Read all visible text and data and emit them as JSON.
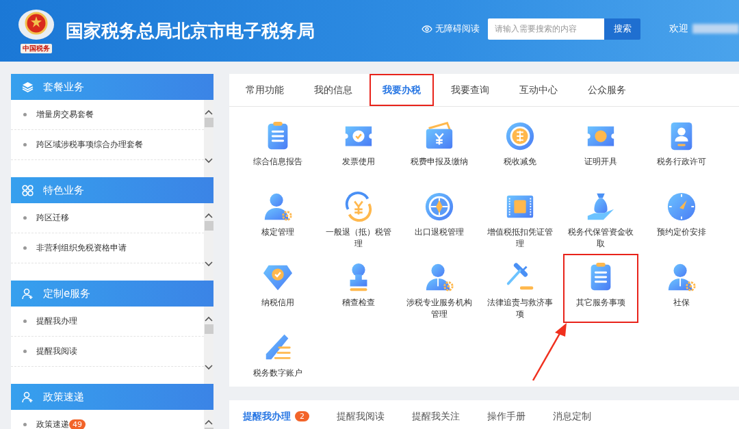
{
  "header": {
    "logo_caption": "中国税务",
    "title": "国家税务总局北京市电子税务局",
    "accessibility_link": "无障碍阅读",
    "search": {
      "placeholder": "请输入需要搜索的内容",
      "button": "搜索"
    },
    "welcome": "欢迎"
  },
  "sidebar": [
    {
      "title": "套餐业务",
      "kind": "layers",
      "items": [
        "增量房交易套餐",
        "跨区域涉税事项综合办理套餐"
      ]
    },
    {
      "title": "特色业务",
      "kind": "grid",
      "items": [
        "跨区迁移",
        "非营利组织免税资格申请"
      ]
    },
    {
      "title": "定制e服务",
      "kind": "person",
      "items": [
        "提醒我办理",
        "提醒我阅读"
      ]
    },
    {
      "title": "政策速递",
      "kind": "person",
      "items": [
        {
          "label": "政策速递",
          "badge": "49"
        }
      ]
    }
  ],
  "tabs": [
    {
      "label": "常用功能",
      "selected": false,
      "highlighted": false
    },
    {
      "label": "我的信息",
      "selected": false,
      "highlighted": false
    },
    {
      "label": "我要办税",
      "selected": true,
      "highlighted": true
    },
    {
      "label": "我要查询",
      "selected": false,
      "highlighted": false
    },
    {
      "label": "互动中心",
      "selected": false,
      "highlighted": false
    },
    {
      "label": "公众服务",
      "selected": false,
      "highlighted": false
    }
  ],
  "services": [
    {
      "label": "综合信息报告",
      "kind": "clipboard",
      "highlighted": false
    },
    {
      "label": "发票使用",
      "kind": "ticket",
      "highlighted": false
    },
    {
      "label": "税费申报及缴纳",
      "kind": "wallet",
      "highlighted": false
    },
    {
      "label": "税收减免",
      "kind": "coin",
      "highlighted": false
    },
    {
      "label": "证明开具",
      "kind": "voucher",
      "highlighted": false
    },
    {
      "label": "税务行政许可",
      "kind": "badge",
      "highlighted": false
    },
    {
      "label": "核定管理",
      "kind": "person-gear",
      "highlighted": false
    },
    {
      "label": "一般退（抵）税管理",
      "kind": "refresh",
      "highlighted": false
    },
    {
      "label": "出口退税管理",
      "kind": "globe",
      "highlighted": false
    },
    {
      "label": "增值税抵扣凭证管理",
      "kind": "card",
      "highlighted": false
    },
    {
      "label": "税务代保管资金收取",
      "kind": "bag",
      "highlighted": false
    },
    {
      "label": "预约定价安排",
      "kind": "compass",
      "highlighted": false
    },
    {
      "label": "纳税信用",
      "kind": "diamond",
      "highlighted": false
    },
    {
      "label": "稽查检查",
      "kind": "stamp",
      "highlighted": false
    },
    {
      "label": "涉税专业服务机构管理",
      "kind": "person-tie",
      "highlighted": false
    },
    {
      "label": "法律追责与救济事项",
      "kind": "gavel",
      "highlighted": false
    },
    {
      "label": "其它服务事项",
      "kind": "clipboard",
      "highlighted": true
    },
    {
      "label": "社保",
      "kind": "person-tie",
      "highlighted": false
    },
    {
      "label": "税务数字账户",
      "kind": "pen",
      "highlighted": false
    }
  ],
  "bottom_tabs": [
    {
      "label": "提醒我办理",
      "selected": true,
      "badge": "2"
    },
    {
      "label": "提醒我阅读",
      "selected": false
    },
    {
      "label": "提醒我关注",
      "selected": false
    },
    {
      "label": "操作手册",
      "selected": false
    },
    {
      "label": "消息定制",
      "selected": false
    }
  ]
}
